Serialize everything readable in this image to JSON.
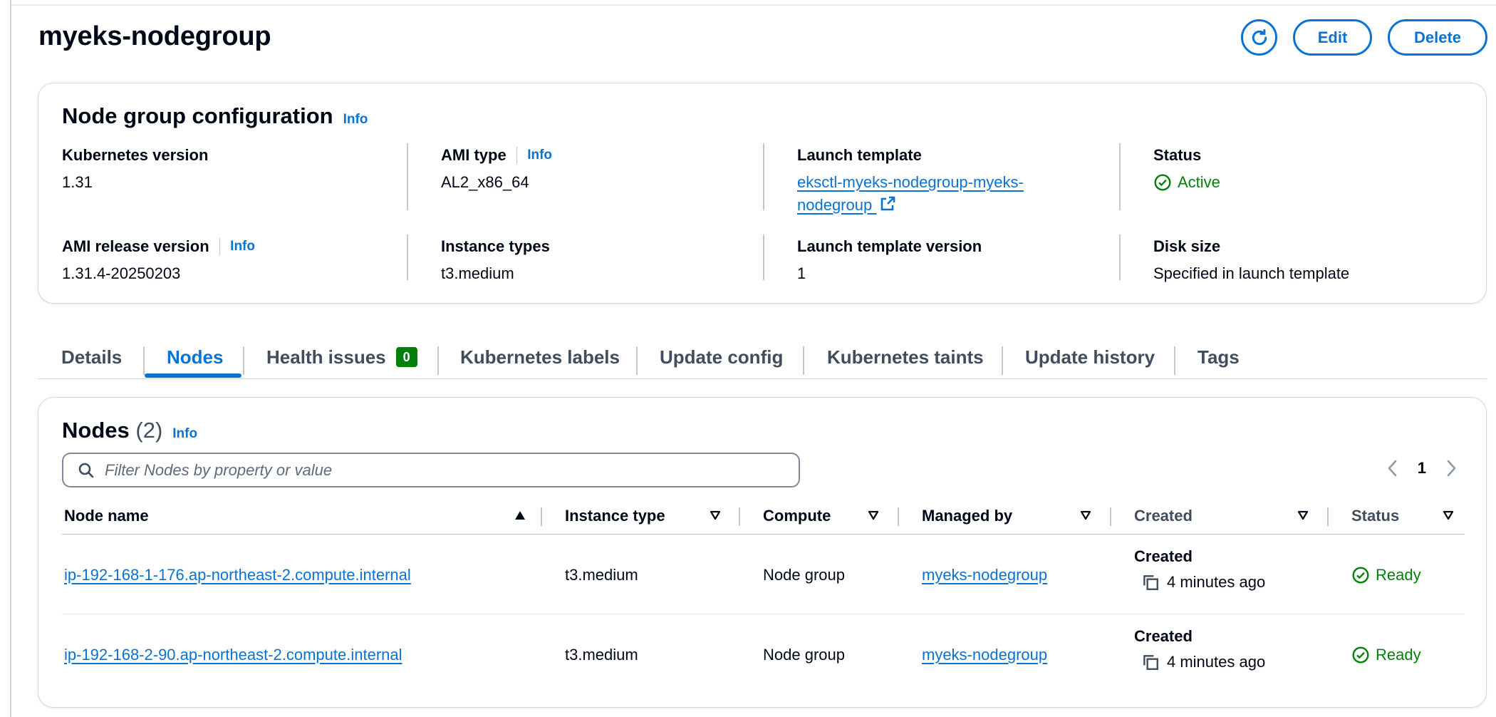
{
  "page": {
    "title": "myeks-nodegroup",
    "actions": {
      "refresh_icon": "refresh-icon",
      "edit_label": "Edit",
      "delete_label": "Delete"
    }
  },
  "config": {
    "title": "Node group configuration",
    "info_label": "Info",
    "kubernetes_version": {
      "label": "Kubernetes version",
      "value": "1.31"
    },
    "ami_type": {
      "label": "AMI type",
      "info_label": "Info",
      "value": "AL2_x86_64"
    },
    "launch_template": {
      "label": "Launch template",
      "value": "eksctl-myeks-nodegroup-myeks-nodegroup",
      "icon": "external-link-icon"
    },
    "status": {
      "label": "Status",
      "value": "Active",
      "icon": "check-circle-icon"
    },
    "ami_release_version": {
      "label": "AMI release version",
      "info_label": "Info",
      "value": "1.31.4-20250203"
    },
    "instance_types": {
      "label": "Instance types",
      "value": "t3.medium"
    },
    "launch_template_version": {
      "label": "Launch template version",
      "value": "1"
    },
    "disk_size": {
      "label": "Disk size",
      "value": "Specified in launch template"
    }
  },
  "tabs": [
    {
      "label": "Details"
    },
    {
      "label": "Nodes",
      "active": true
    },
    {
      "label": "Health issues",
      "badge": "0"
    },
    {
      "label": "Kubernetes labels"
    },
    {
      "label": "Update config"
    },
    {
      "label": "Kubernetes taints"
    },
    {
      "label": "Update history"
    },
    {
      "label": "Tags"
    }
  ],
  "nodes": {
    "title": "Nodes",
    "count": "(2)",
    "info_label": "Info",
    "search_placeholder": "Filter Nodes by property or value",
    "page_number": "1",
    "columns": [
      "Node name",
      "Instance type",
      "Compute",
      "Managed by",
      "Created",
      "Status"
    ],
    "rows": [
      {
        "node_name": "ip-192-168-1-176.ap-northeast-2.compute.internal",
        "instance_type": "t3.medium",
        "compute": "Node group",
        "managed_by": "myeks-nodegroup",
        "created_label": "Created",
        "created_time": "4 minutes ago",
        "status": "Ready"
      },
      {
        "node_name": "ip-192-168-2-90.ap-northeast-2.compute.internal",
        "instance_type": "t3.medium",
        "compute": "Node group",
        "managed_by": "myeks-nodegroup",
        "created_label": "Created",
        "created_time": "4 minutes ago",
        "status": "Ready"
      }
    ]
  },
  "colors": {
    "link": "#0972d3",
    "success": "#037f0c",
    "text": "#000716"
  }
}
